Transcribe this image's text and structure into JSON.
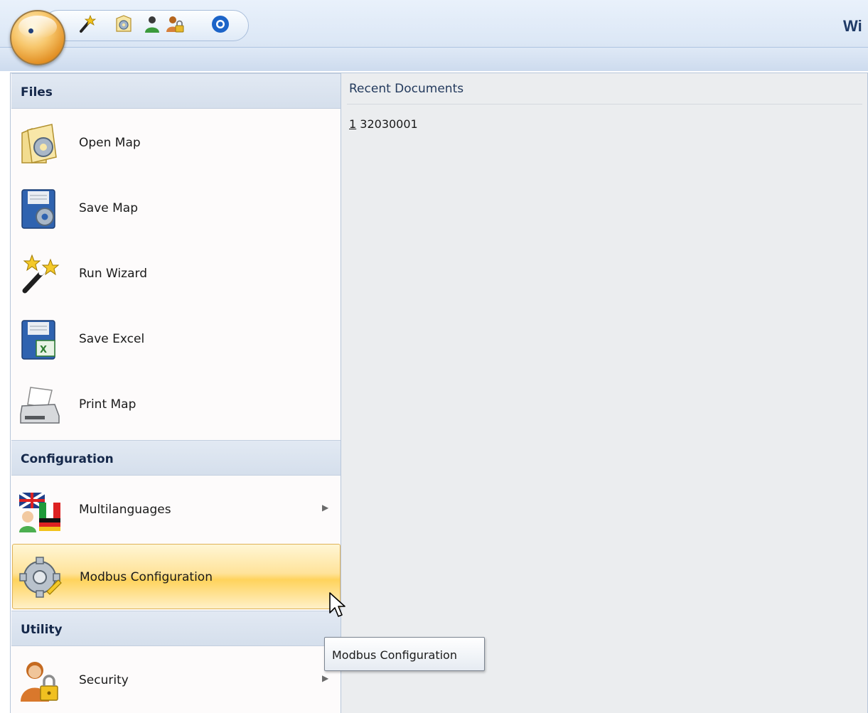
{
  "window": {
    "title": "Wi"
  },
  "quick_access": [
    {
      "icon": "magic-wand-icon"
    },
    {
      "icon": "document-gear-icon"
    },
    {
      "icon": "user-green-icon"
    },
    {
      "icon": "user-lock-icon"
    },
    {
      "icon": "blue-circle-icon"
    }
  ],
  "menu": {
    "sections": {
      "files": "Files",
      "configuration": "Configuration",
      "utility": "Utility"
    },
    "items": {
      "open_map": "Open Map",
      "save_map": "Save Map",
      "run_wizard": "Run Wizard",
      "save_excel": "Save Excel",
      "print_map": "Print Map",
      "multilanguages": "Multilanguages",
      "modbus_configuration": "Modbus Configuration",
      "security": "Security"
    },
    "hovered_item": "Modbus Configuration"
  },
  "recent": {
    "title": "Recent Documents",
    "documents": [
      {
        "accelerator": "1",
        "name": "32030001"
      }
    ]
  },
  "tooltip": {
    "text": "Modbus Configuration"
  },
  "colors": {
    "accent_hover": "#ffd35c",
    "header_text": "#15284a",
    "panel_bg": "#ebedef"
  }
}
